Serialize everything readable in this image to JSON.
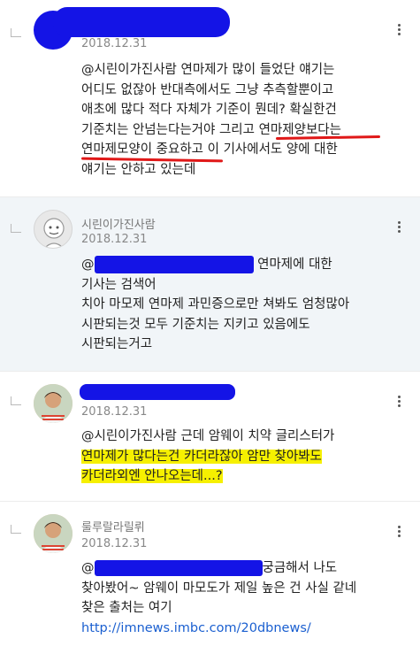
{
  "comments": [
    {
      "author": "",
      "date": "2018.12.31",
      "lines": [
        "@시린이가진사람 연마제가 많이 들었단 얘기는",
        "어디도 없잖아 반대측에서도 그냥 추측할뿐이고",
        "애초에 많다 적다 자체가 기준이 뭔데? 확실한건",
        "기준치는 안넘는다는거야 그리고 연마제양보다는",
        "연마제모양이 중요하고 이 기사에서도 양에 대한",
        "얘기는 안하고 있는데"
      ]
    },
    {
      "author": "시린이가진사람",
      "date": "2018.12.31",
      "mention_tail": "연마제에 대한",
      "lines": [
        "기사는 검색어",
        "치아 마모제 연마제 과민증으로만 쳐봐도 엄청많아",
        "시판되는것 모두 기준치는 지키고 있음에도",
        "시판되는거고"
      ]
    },
    {
      "author": "",
      "date": "2018.12.31",
      "lines": [
        "@시린이가진사람 근데 암웨이 치약 글리스터가",
        "연마제가 많다는건 카더라잖아 암만 찾아봐도",
        "카더라외엔 안나오는데...?"
      ]
    },
    {
      "author": "룰루랄라릴뤼",
      "date": "2018.12.31",
      "mention_tail": "궁금해서 나도",
      "lines": [
        "찾아봤어~ 암웨이 마모도가 제일 높은 건 사실 같네",
        "찾은 출처는 여기",
        "http://imnews.imbc.com/20dbnews/"
      ]
    }
  ],
  "colors": {
    "highlight": "#f6f000",
    "redaction": "#1414e6",
    "underline": "#e01818",
    "alt_bg": "#f1f5f8",
    "link": "#1a5fd0"
  },
  "icons": {
    "more": "more-vertical-icon",
    "reply": "reply-indent-icon"
  }
}
